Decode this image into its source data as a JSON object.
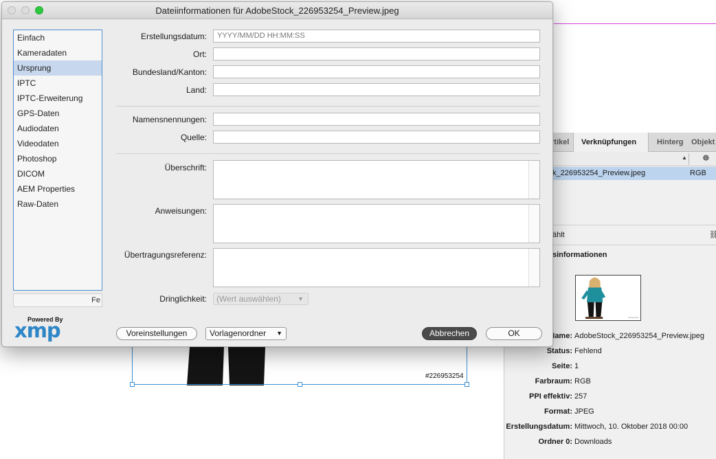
{
  "dialog": {
    "title": "Dateiinformationen für AdobeStock_226953254_Preview.jpeg",
    "categories": [
      "Einfach",
      "Kameradaten",
      "Ursprung",
      "IPTC",
      "IPTC-Erweiterung",
      "GPS-Daten",
      "Audiodaten",
      "Videodaten",
      "Photoshop",
      "DICOM",
      "AEM Properties",
      "Raw-Daten"
    ],
    "selected_category": "Ursprung",
    "category_search_value": "Fe",
    "xmp": {
      "powered_by": "Powered By",
      "logo_text": "xmp"
    },
    "fields": {
      "erstellungsdatum": {
        "label": "Erstellungsdatum:",
        "placeholder": "YYYY/MM/DD HH:MM:SS",
        "value": ""
      },
      "ort": {
        "label": "Ort:",
        "value": ""
      },
      "bundesland": {
        "label": "Bundesland/Kanton:",
        "value": ""
      },
      "land": {
        "label": "Land:",
        "value": ""
      },
      "namensnennungen": {
        "label": "Namensnennungen:",
        "value": ""
      },
      "quelle": {
        "label": "Quelle:",
        "value": ""
      },
      "ueberschrift": {
        "label": "Überschrift:",
        "value": ""
      },
      "anweisungen": {
        "label": "Anweisungen:",
        "value": ""
      },
      "uebertragungsreferenz": {
        "label": "Übertragungsreferenz:",
        "value": ""
      },
      "dringlichkeit": {
        "label": "Dringlichkeit:",
        "value": "(Wert auswählen)"
      }
    },
    "buttons": {
      "voreinstellungen": "Voreinstellungen",
      "vorlagenordner": "Vorlagenordner",
      "abbrechen": "Abbrechen",
      "ok": "OK"
    }
  },
  "document": {
    "frame_id": "#226953254"
  },
  "links_panel": {
    "tabs": [
      "rtikel",
      "Verknüpfungen",
      "Hinterg",
      "Objekt"
    ],
    "active_tab": "Verknüpfungen",
    "row": {
      "name": "k_226953254_Preview.jpeg",
      "colorspace": "RGB"
    },
    "selected_text": "ählt",
    "info_title": "sinformationen",
    "props": [
      {
        "key": "Name:",
        "value": "AdobeStock_226953254_Preview.jpeg"
      },
      {
        "key": "Status:",
        "value": "Fehlend"
      },
      {
        "key": "Seite:",
        "value": "1"
      },
      {
        "key": "Farbraum:",
        "value": "RGB"
      },
      {
        "key": "PPI effektiv:",
        "value": "257"
      },
      {
        "key": "Format:",
        "value": "JPEG"
      },
      {
        "key": "Erstellungsdatum:",
        "value": "Mittwoch, 10. Oktober 2018 00:00"
      },
      {
        "key": "Ordner 0:",
        "value": "Downloads"
      }
    ]
  },
  "colors": {
    "accent": "#2f86c7",
    "selection": "#c7d8ee",
    "guide": "#d740d7"
  }
}
